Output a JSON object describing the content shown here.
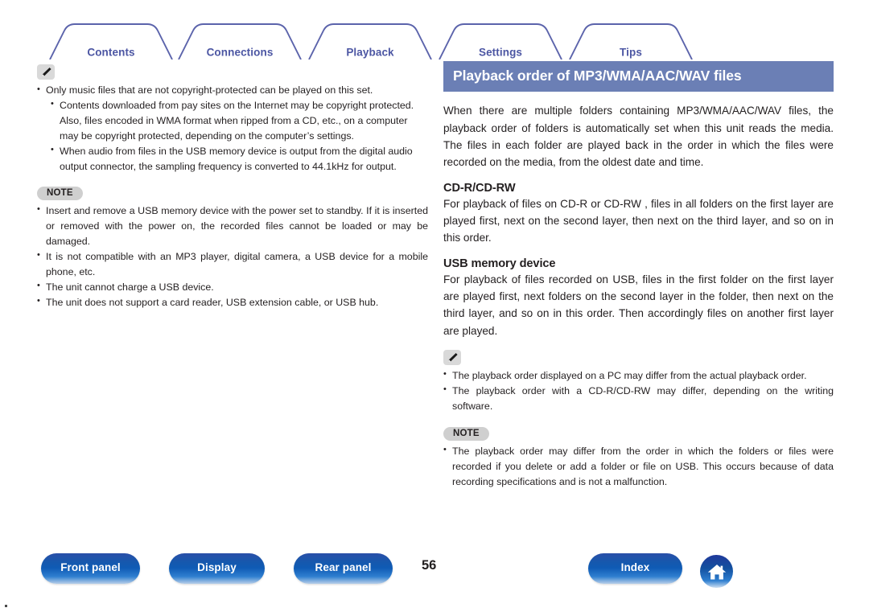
{
  "tabs": [
    {
      "label": "Contents",
      "name": "tab-contents"
    },
    {
      "label": "Connections",
      "name": "tab-connections"
    },
    {
      "label": "Playback",
      "name": "tab-playback"
    },
    {
      "label": "Settings",
      "name": "tab-settings"
    },
    {
      "label": "Tips",
      "name": "tab-tips"
    }
  ],
  "colors": {
    "tab_outline": "#5b63ab",
    "tab_text": "#4c56a3",
    "banner_bg": "#6b7fb5",
    "button_blue": "#1658ad",
    "badge_gray": "#cfcfcf"
  },
  "left_column": {
    "note_icon_label": "pencil-icon",
    "tips": [
      "Only music files that are not copyright-protected can be played on this set."
    ],
    "sub_tips": [
      "Contents downloaded from pay sites on the Internet may be copyright protected. Also, files encoded in WMA format when ripped from a CD, etc., on a computer may be copyright protected, depending on the computer’s settings.",
      "When audio from files in the USB memory device is output from the digital audio output connector, the sampling frequency is converted to 44.1kHz for output."
    ],
    "note_label": "NOTE",
    "notes": [
      "Insert and remove a USB memory device with the power set to standby. If it is inserted or removed with the power on, the recorded files cannot be loaded or may be damaged.",
      "It is not compatible with an MP3 player, digital camera, a USB device for a mobile phone, etc.",
      "The unit cannot charge a USB device.",
      "The unit does not support a card reader, USB extension cable, or USB hub."
    ]
  },
  "right_column": {
    "heading": "Playback order of MP3/WMA/AAC/WAV files",
    "intro": "When there are multiple folders containing MP3/WMA/AAC/WAV files, the playback order of folders is automatically set when this unit reads the media. The files in each folder are played back in the order in which the files were recorded on the media, from the oldest date and time.",
    "section1_title": "CD-R/CD-RW",
    "section1_body": "For playback of files on CD-R or CD-RW , files in all folders on the first layer are played first, next on the second layer, then next on the third layer, and so on in this order.",
    "section2_title": "USB memory device",
    "section2_body": "For playback of files recorded on USB, files in the first folder on the first layer are played first, next folders on the second layer in the folder, then next on the third layer, and so on in this order. Then accordingly files on another first layer are played.",
    "tip_icon_label": "pencil-icon",
    "tips": [
      "The playback order displayed on a PC may differ from the actual playback order.",
      "The playback order with a CD-R/CD-RW may differ, depending on the writing software."
    ],
    "note_label": "NOTE",
    "notes": [
      "The playback order may differ from the order in which the folders or files were recorded if you delete or add a folder or file on USB. This occurs because of data recording specifications and is not a malfunction."
    ]
  },
  "footer": {
    "buttons": [
      {
        "label": "Front panel",
        "name": "front-panel-button"
      },
      {
        "label": "Display",
        "name": "display-button"
      },
      {
        "label": "Rear panel",
        "name": "rear-panel-button"
      },
      {
        "label": "Index",
        "name": "index-button"
      }
    ],
    "page_number": "56",
    "home_icon": "home-icon"
  }
}
